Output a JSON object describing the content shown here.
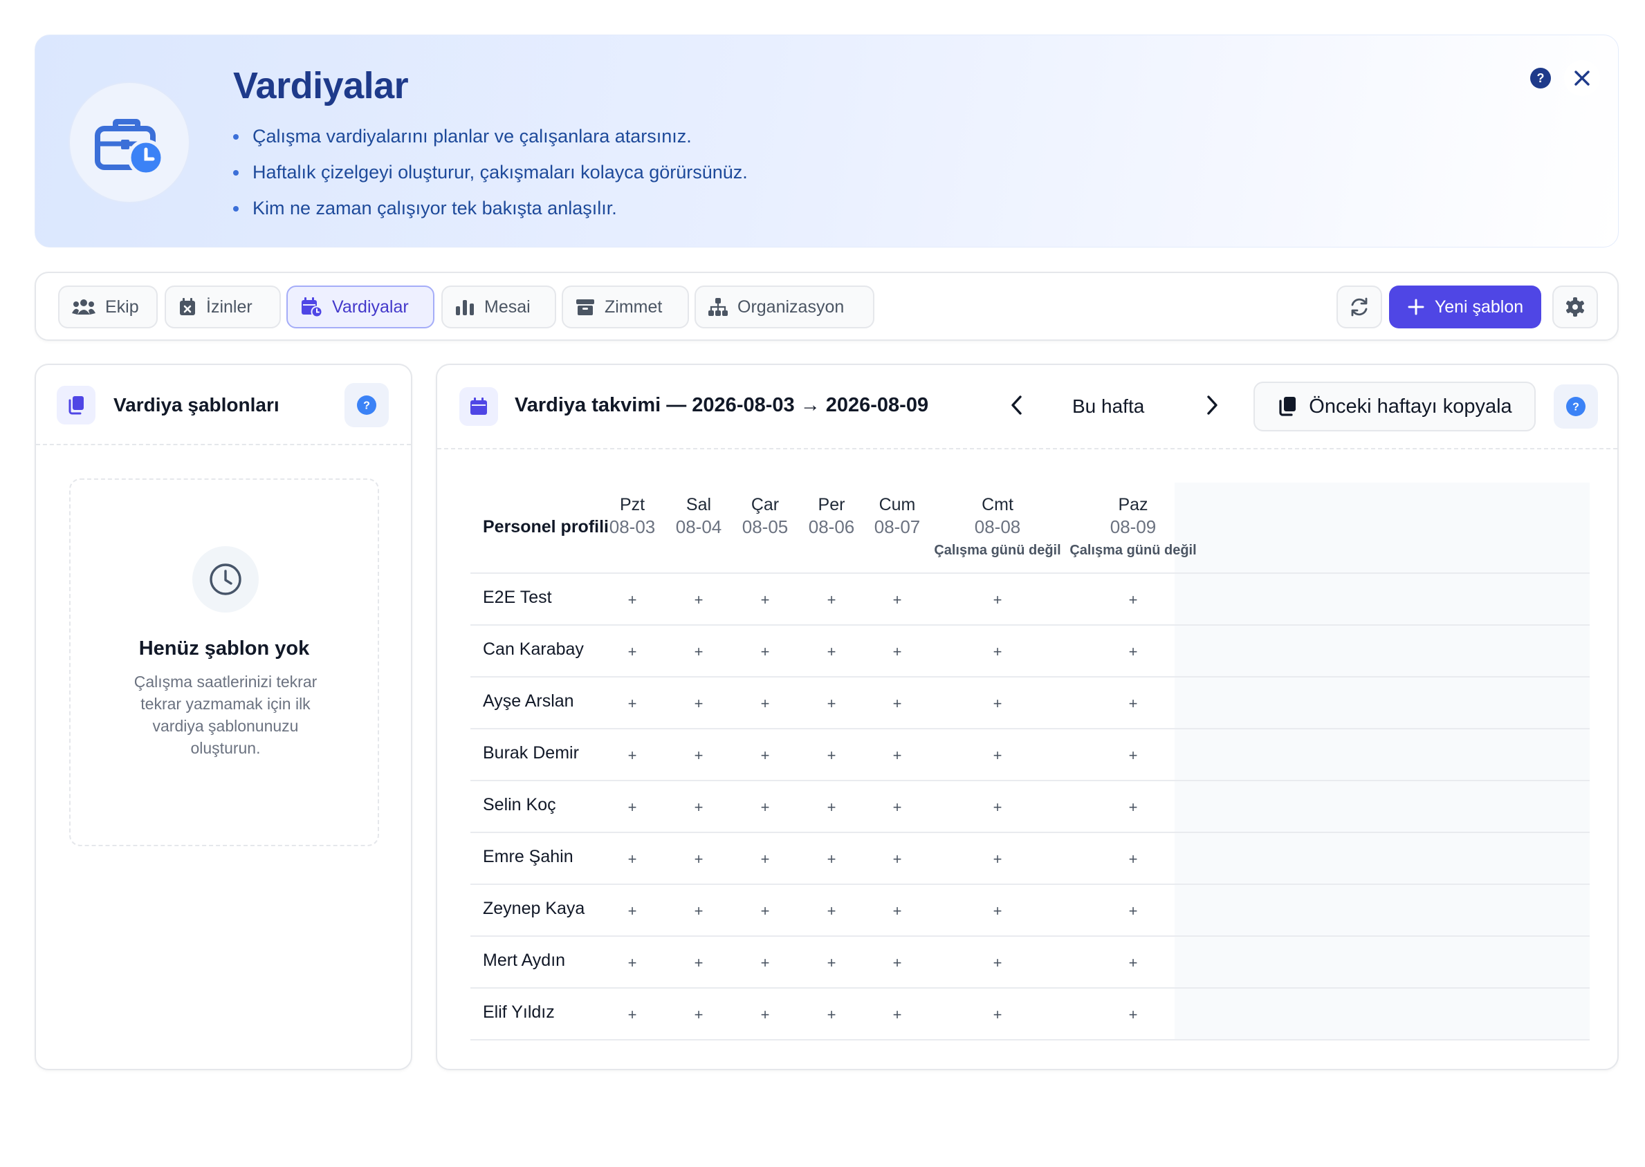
{
  "hero": {
    "title": "Vardiyalar",
    "bullets": [
      "Çalışma vardiyalarını planlar ve çalışanlara atarsınız.",
      "Haftalık çizelgeyi oluşturur, çakışmaları kolayca görürsünüz.",
      "Kim ne zaman çalışıyor tek bakışta anlaşılır."
    ],
    "help_glyph": "?",
    "close_glyph": "✕"
  },
  "nav": {
    "tabs": [
      {
        "label": "Ekip",
        "icon": "users-icon"
      },
      {
        "label": "İzinler",
        "icon": "calendar-x-icon"
      },
      {
        "label": "Vardiyalar",
        "icon": "calendar-clock-icon",
        "active": true
      },
      {
        "label": "Mesai",
        "icon": "bar-chart-icon"
      },
      {
        "label": "Zimmet",
        "icon": "archive-box-icon"
      },
      {
        "label": "Organizasyon",
        "icon": "org-chart-icon"
      }
    ],
    "new_template_label": "Yeni şablon"
  },
  "templates_panel": {
    "title": "Vardiya şablonları",
    "help_glyph": "?",
    "empty_title": "Henüz şablon yok",
    "empty_desc": "Çalışma saatlerinizi tekrar tekrar yazmamak için ilk vardiya şablonunuzu oluşturun."
  },
  "calendar": {
    "title": "Vardiya takvimi — 2026-08-03 → 2026-08-09",
    "this_week_label": "Bu hafta",
    "copy_prev_label": "Önceki haftayı kopyala",
    "help_glyph": "?",
    "profile_header": "Personel profili",
    "cell_glyph": "+",
    "days": [
      {
        "name": "Pzt",
        "date": "08-03",
        "note": ""
      },
      {
        "name": "Sal",
        "date": "08-04",
        "note": ""
      },
      {
        "name": "Çar",
        "date": "08-05",
        "note": ""
      },
      {
        "name": "Per",
        "date": "08-06",
        "note": ""
      },
      {
        "name": "Cum",
        "date": "08-07",
        "note": ""
      },
      {
        "name": "Cmt",
        "date": "08-08",
        "note": "Çalışma günü değil"
      },
      {
        "name": "Paz",
        "date": "08-09",
        "note": "Çalışma günü değil"
      }
    ],
    "staff": [
      "E2E Test",
      "Can Karabay",
      "Ayşe Arslan",
      "Burak Demir",
      "Selin Koç",
      "Emre Şahin",
      "Zeynep Kaya",
      "Mert Aydın",
      "Elif Yıldız"
    ]
  },
  "colors": {
    "accent": "#4f46e5",
    "hero_title": "#1e3a8a",
    "help_blue": "#3b82f6"
  }
}
